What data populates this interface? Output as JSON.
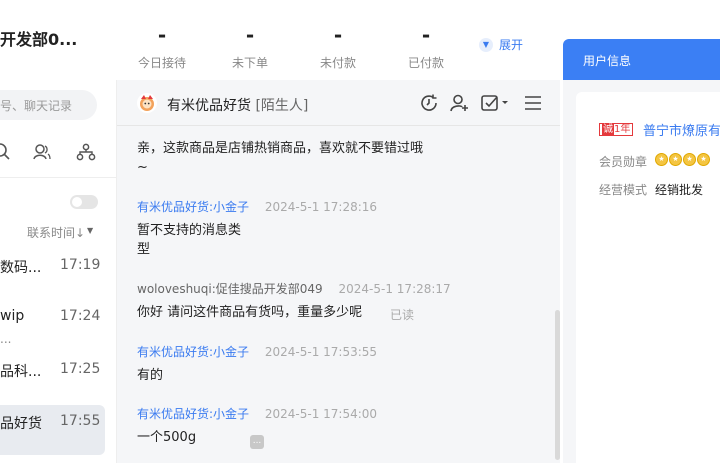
{
  "header": {
    "shop_title": "开发部0...",
    "stats": [
      {
        "value": "-",
        "label": "今日接待"
      },
      {
        "value": "-",
        "label": "未下单"
      },
      {
        "value": "-",
        "label": "未付款"
      },
      {
        "value": "-",
        "label": "已付款"
      }
    ],
    "expand_label": "展开",
    "user_info_tab": "用户信息"
  },
  "sidebar": {
    "search_placeholder": "号、聊天记录",
    "sort_label": "联系时间↓",
    "conversations": [
      {
        "name": "数码...",
        "time": "17:19"
      },
      {
        "name": "wip",
        "sub": "...",
        "time": "17:24"
      },
      {
        "name": "品科...",
        "time": "17:25"
      },
      {
        "name": "品好货",
        "time": "17:55"
      }
    ]
  },
  "chat": {
    "peer_name": "有米优品好货",
    "peer_tag": "[陌生人]",
    "messages": [
      {
        "text_lines": [
          "亲，这款商品是店铺热销商品，喜欢就不要错过哦",
          "~"
        ]
      },
      {
        "sender": "有米优品好货:小金子",
        "time": "2024-5-1 17:28:16",
        "text_lines": [
          "暂不支持的消息类",
          "型"
        ]
      },
      {
        "sender": "woloveshuqi:促佳搜品开发部049",
        "time": "2024-5-1 17:28:17",
        "text_lines": [
          "你好 请问这件商品有货吗，重量多少呢"
        ],
        "status": "已读"
      },
      {
        "sender": "有米优品好货:小金子",
        "time": "2024-5-1 17:53:55",
        "text_lines": [
          "有的"
        ]
      },
      {
        "sender": "有米优品好货:小金子",
        "time": "2024-5-1 17:54:00",
        "text_lines": [
          "一个500g"
        ]
      }
    ],
    "more_icon": "..."
  },
  "user_info": {
    "badge_prefix": "诚",
    "badge_years": "1年",
    "company": "普宁市燎原有",
    "medal_label": "会员勋章",
    "mode_label": "经营模式",
    "mode_value": "经销批发"
  },
  "colors": {
    "accent": "#3b7ff4",
    "link": "#3a7bf0",
    "badge_red": "#e4393c"
  }
}
